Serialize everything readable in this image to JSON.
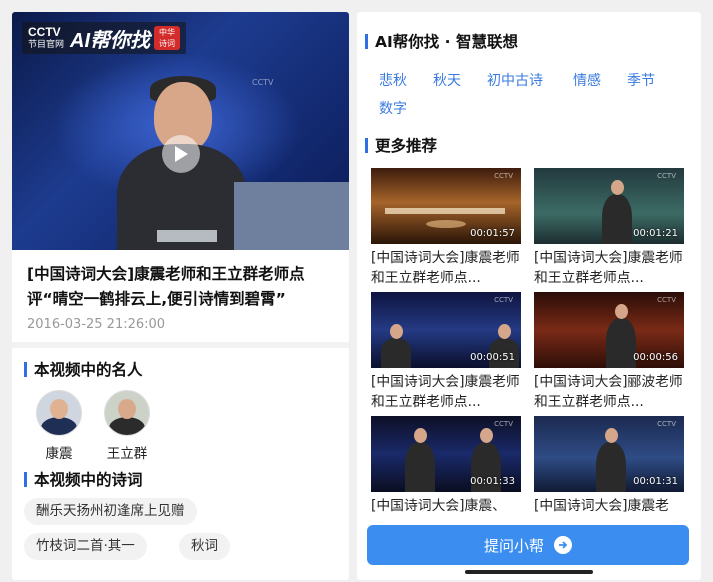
{
  "left": {
    "player": {
      "logo_cctv": "CCTV",
      "logo_sub": "节目官网",
      "logo_ai": "AI帮你找",
      "seal_text": "中华诗词",
      "screen_mark": "CCTV"
    },
    "video": {
      "title": "[中国诗词大会]康震老师和王立群老师点评“晴空一鹤排云上,便引诗情到碧霄”",
      "time": "2016-03-25 21:26:00"
    },
    "celebrities_heading": "本视频中的名人",
    "celebrities": [
      {
        "name": "康震"
      },
      {
        "name": "王立群"
      }
    ],
    "poems_heading": "本视频中的诗词",
    "poems": [
      "酬乐天扬州初逢席上见赠",
      "竹枝词二首·其一",
      "秋词"
    ]
  },
  "right": {
    "ai_heading": "AI帮你找 · 智慧联想",
    "keywords": [
      "悲秋",
      "秋天",
      "初中古诗",
      "情感",
      "季节",
      "数字"
    ],
    "more_heading": "更多推荐",
    "recommendations": [
      {
        "title": "[中国诗词大会]康震老师和王立群老师点...",
        "duration": "00:01:57"
      },
      {
        "title": "[中国诗词大会]康震老师和王立群老师点...",
        "duration": "00:01:21"
      },
      {
        "title": "[中国诗词大会]康震老师和王立群老师点...",
        "duration": "00:00:51"
      },
      {
        "title": "[中国诗词大会]郦波老师和王立群老师点...",
        "duration": "00:00:56"
      },
      {
        "title": "[中国诗词大会]康震、",
        "duration": "00:01:33"
      },
      {
        "title": "[中国诗词大会]康震老",
        "duration": "00:01:31"
      }
    ],
    "ask_button": "提问小帮"
  },
  "colors": {
    "accent": "#2f6fe0",
    "keyword": "#3a7be0",
    "button": "#3b8ef0"
  }
}
